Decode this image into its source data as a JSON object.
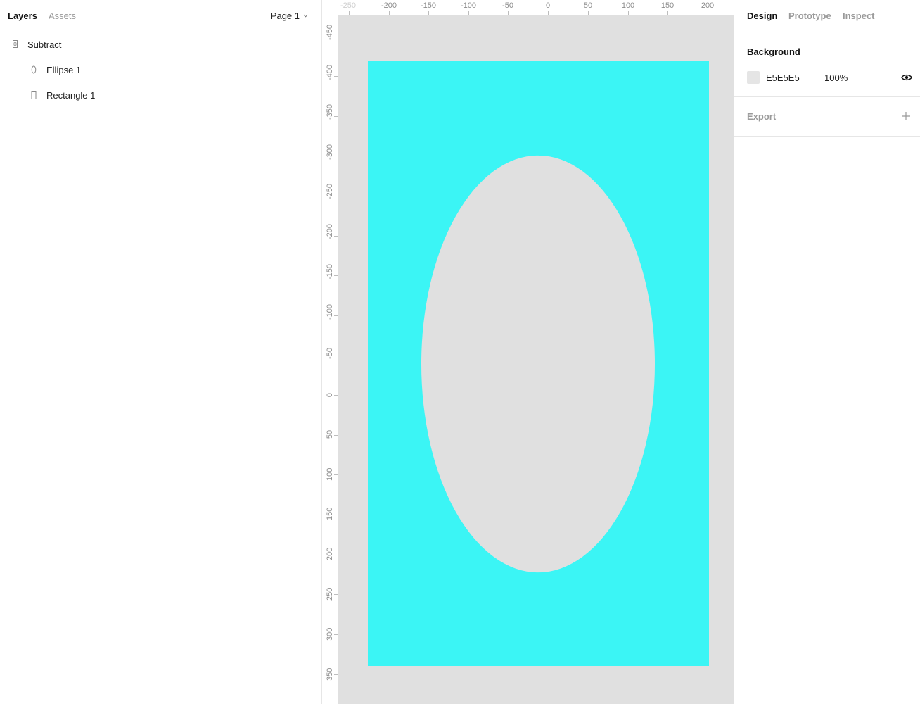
{
  "left_panel": {
    "tabs": [
      "Layers",
      "Assets"
    ],
    "page_select": "Page 1",
    "layers": [
      {
        "name": "Subtract",
        "icon": "subtract-icon"
      },
      {
        "name": "Ellipse 1",
        "icon": "ellipse-icon"
      },
      {
        "name": "Rectangle 1",
        "icon": "rectangle-icon"
      }
    ]
  },
  "canvas": {
    "ruler_x_labels": [
      "-250",
      "-200",
      "-150",
      "-100",
      "-50",
      "0",
      "50",
      "100",
      "150",
      "200"
    ],
    "ruler_y_labels": [
      "-450",
      "-400",
      "-350",
      "-300",
      "-250",
      "-200",
      "-150",
      "-100",
      "-50",
      "0",
      "50",
      "100",
      "150",
      "200",
      "250",
      "300",
      "350"
    ],
    "background_color": "#E0E0E0",
    "shape_fill_color": "#3BF5F5"
  },
  "right_panel": {
    "tabs": [
      "Design",
      "Prototype",
      "Inspect"
    ],
    "background": {
      "title": "Background",
      "hex": "E5E5E5",
      "opacity": "100%",
      "swatch_color": "#E5E5E5"
    },
    "export": {
      "title": "Export"
    }
  }
}
